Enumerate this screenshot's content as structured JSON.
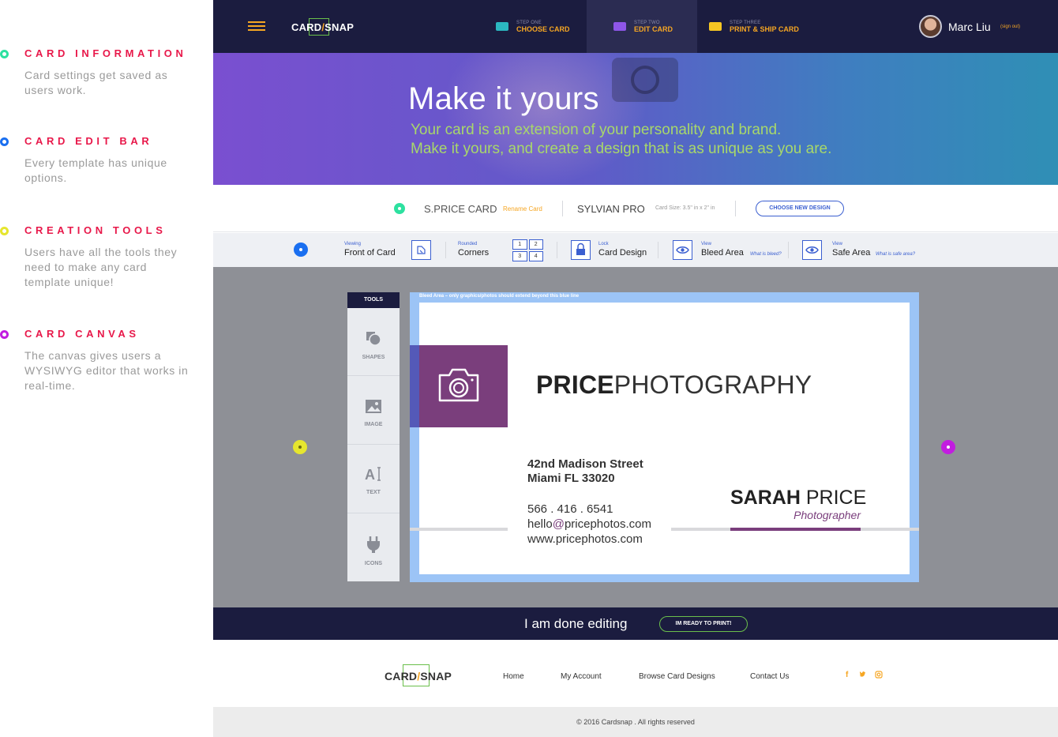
{
  "annotations": [
    {
      "title": "CARD INFORMATION",
      "text": "Card settings get saved as users work.",
      "color": "#2de1a0"
    },
    {
      "title": "CARD EDIT BAR",
      "text": "Every template has unique options.",
      "color": "#1a6ff0"
    },
    {
      "title": "CREATION TOOLS",
      "text": "Users have all the tools they need to make any card template unique!",
      "color": "#e6e62e"
    },
    {
      "title": "CARD CANVAS",
      "text": "The canvas gives users a WYSIWYG editor that works in real-time.",
      "color": "#c21de0"
    }
  ],
  "header": {
    "logo_left": "CARD",
    "logo_right": "SNAP",
    "steps": [
      {
        "small": "STEP ONE",
        "label": "CHOOSE CARD",
        "color": "#2bb7c0"
      },
      {
        "small": "STEP TWO",
        "label": "EDIT CARD",
        "color": "#8e56e8"
      },
      {
        "small": "STEP THREE",
        "label": "PRINT & SHIP CARD",
        "color": "#f6c623"
      }
    ],
    "user_name": "Marc Liu",
    "sign_out": "(sign out)"
  },
  "hero": {
    "title": "Make it yours",
    "line1": "Your card is an extension of your personality and brand.",
    "line2": "Make it yours, and create a design that is as unique as you are."
  },
  "card_info": {
    "card_name": "S.PRICE CARD",
    "rename": "Rename Card",
    "design_name": "SYLVIAN PRO",
    "card_size": "Card Size: 3.5\" in x 2\" in",
    "choose_new": "CHOOSE NEW DESIGN"
  },
  "edit_bar": {
    "viewing_small": "Viewing",
    "viewing_big": "Front of Card",
    "rounded_small": "Rounded",
    "rounded_big": "Corners",
    "corners": [
      "1",
      "2",
      "3",
      "4"
    ],
    "lock_small": "Lock",
    "lock_big": "Card Design",
    "bleed_small": "View",
    "bleed_big": "Bleed Area",
    "bleed_q": "What is bleed?",
    "safe_small": "View",
    "safe_big": "Safe Area",
    "safe_q": "What is safe area?"
  },
  "tools": {
    "header": "TOOLS",
    "items": [
      "SHAPES",
      "IMAGE",
      "TEXT",
      "ICONS"
    ]
  },
  "canvas": {
    "bleed_note": "Bleed Area – only graphics/photos should extend beyond this blue line",
    "brand_bold": "PRICE",
    "brand_light": "PHOTOGRAPHY",
    "address1": "42nd Madison Street",
    "address2": "Miami FL 33020",
    "phone": "566 . 416 . 6541",
    "email_pre": "hello",
    "email_at": "@",
    "email_post": "pricephotos.com",
    "web": "www.pricephotos.com",
    "name_bold": "SARAH",
    "name_light": "PRICE",
    "role": "Photographer",
    "accent": "#7a3e7c"
  },
  "done_bar": {
    "text": "I am done editing",
    "button": "IM READY TO PRINT!"
  },
  "footer": {
    "links": [
      "Home",
      "My Account",
      "Browse Card Designs",
      "Contact Us"
    ],
    "social": [
      "f",
      "t",
      "o"
    ],
    "copyright": "© 2016 Cardsnap . All rights reserved"
  }
}
